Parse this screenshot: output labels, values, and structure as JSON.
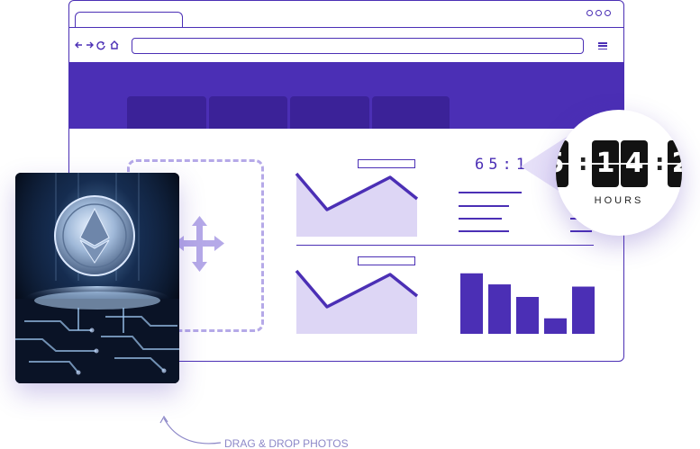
{
  "counter": {
    "text": "65:14:",
    "zoom_digits": [
      "14"
    ],
    "zoom_partial_left": "5",
    "zoom_partial_right": "2",
    "unit_label": "HOURS"
  },
  "caption": "DRAG & DROP PHOTOS",
  "colors": {
    "accent": "#4b2fb5",
    "accent_dark": "#3b2298",
    "accent_light": "#ddd6f5",
    "dashed": "#b5a9e8"
  },
  "icons": {
    "nav": [
      "arrow-left-icon",
      "arrow-right-icon",
      "refresh-icon",
      "home-icon"
    ],
    "menu": "hamburger-menu-icon",
    "move": "move-arrows-icon",
    "window_controls": "three-dots-icon"
  },
  "bar_chart": {
    "values": [
      82,
      67,
      50,
      21,
      64
    ]
  }
}
